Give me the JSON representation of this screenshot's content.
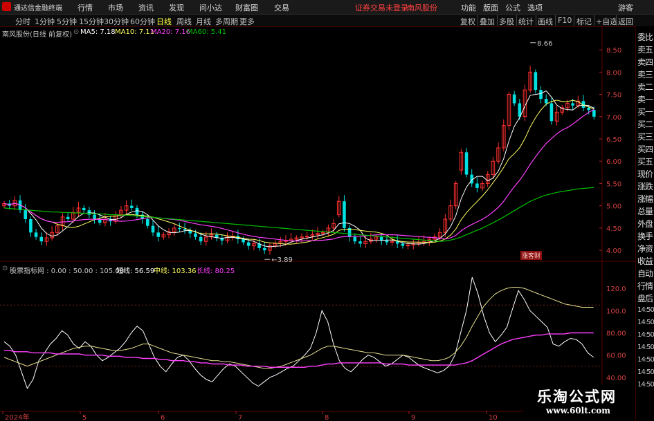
{
  "menubar": {
    "app_name": "通达信金融终端",
    "items": [
      "行情",
      "市场",
      "资讯",
      "发现",
      "问小达",
      "财富圈",
      "交易"
    ],
    "alert1": "证券交易未登录",
    "alert2": "南风股份",
    "right_items": [
      "功能",
      "版面",
      "公式",
      "选项"
    ],
    "guest": "游客"
  },
  "toolbar": {
    "periods": [
      "分时",
      "1分钟",
      "5分钟",
      "15分钟",
      "30分钟",
      "60分钟",
      "日线",
      "周线",
      "月线",
      "多周期",
      "更多"
    ],
    "active_period": "日线",
    "right_items": [
      "复权",
      "叠加",
      "多股",
      "统计",
      "画线",
      "F10",
      "标记",
      "+自选",
      "返回"
    ]
  },
  "kline_legend": {
    "stock": "南风股份(日线 前复权)",
    "ma5": "MA5: 7.18",
    "ma10": "MA10: 7.11",
    "ma20": "MA20: 7.16",
    "ma60": "MA60: 5.41"
  },
  "indicator_legend": {
    "name": "股票指标网 : 0.00 : 50.00 : 105.00",
    "short": "短线: 56.59",
    "mid": "中线: 103.36",
    "long": "长线: 80.25"
  },
  "sidebar": {
    "labels": [
      "委比",
      "卖五",
      "卖四",
      "卖三",
      "卖二",
      "卖一",
      "买一",
      "买二",
      "买三",
      "买四",
      "买五",
      "现价",
      "涨跌",
      "涨幅",
      "总量",
      "外盘",
      "换手",
      "净资",
      "收益",
      "自动",
      "行情",
      "盘后",
      "14:50",
      "14:50",
      "14:50",
      "14:50",
      "14:50",
      "14:50",
      "14:50"
    ]
  },
  "badge": "涨客财",
  "watermark": {
    "line1": "乐淘公式网",
    "line2": "www.60lt.com"
  },
  "colors": {
    "up": "#ff3030",
    "down": "#00e0e0",
    "ma5": "#ffffff",
    "ma10": "#ffff60",
    "ma20": "#ff40ff",
    "ma60": "#00c000"
  },
  "chart_data": [
    {
      "type": "candlestick",
      "title": "南风股份(日线 前复权)",
      "y_ticks": [
        4.0,
        4.5,
        5.0,
        5.5,
        6.0,
        6.5,
        7.0,
        7.5,
        8.0,
        8.5
      ],
      "ylim": [
        3.8,
        8.75
      ],
      "x_ticks": [
        "2024年",
        "5",
        "6",
        "7",
        "8",
        "9",
        "10"
      ],
      "annotations": {
        "high": "8.66",
        "low": "3.89"
      },
      "legend": [
        "MA5: 7.18",
        "MA10: 7.11",
        "MA20: 7.16",
        "MA60: 5.41"
      ],
      "series_close": [
        5.05,
        5.0,
        5.12,
        4.9,
        4.7,
        4.4,
        4.3,
        4.2,
        4.28,
        4.4,
        4.55,
        4.75,
        4.7,
        4.85,
        4.95,
        4.9,
        4.8,
        4.7,
        4.62,
        4.7,
        4.65,
        4.8,
        4.9,
        5.0,
        4.95,
        4.8,
        4.7,
        4.55,
        4.4,
        4.3,
        4.35,
        4.42,
        4.5,
        4.48,
        4.45,
        4.38,
        4.3,
        4.2,
        4.3,
        4.35,
        4.28,
        4.22,
        4.3,
        4.32,
        4.25,
        4.18,
        4.1,
        4.15,
        4.05,
        4.0,
        4.1,
        4.15,
        4.2,
        4.22,
        4.25,
        4.28,
        4.3,
        4.32,
        4.35,
        4.38,
        4.4,
        4.5,
        4.6,
        5.1,
        4.5,
        4.3,
        4.2,
        4.15,
        4.2,
        4.25,
        4.3,
        4.22,
        4.18,
        4.2,
        4.15,
        4.1,
        4.12,
        4.15,
        4.18,
        4.2,
        4.25,
        4.3,
        4.4,
        4.7,
        5.0,
        5.5,
        6.2,
        5.7,
        5.5,
        5.4,
        5.5,
        5.7,
        6.0,
        6.3,
        6.8,
        7.5,
        7.3,
        7.0,
        7.6,
        8.0,
        7.6,
        7.4,
        7.3,
        6.9,
        7.1,
        7.2,
        7.3,
        7.25,
        7.35,
        7.2,
        7.15,
        7.0
      ],
      "series_open": [
        5.0,
        5.05,
        5.0,
        5.12,
        4.9,
        4.7,
        4.4,
        4.3,
        4.2,
        4.28,
        4.4,
        4.55,
        4.75,
        4.7,
        4.85,
        4.95,
        4.9,
        4.8,
        4.7,
        4.62,
        4.7,
        4.65,
        4.8,
        4.9,
        5.0,
        4.95,
        4.8,
        4.7,
        4.55,
        4.4,
        4.3,
        4.35,
        4.42,
        4.5,
        4.48,
        4.45,
        4.38,
        4.3,
        4.2,
        4.3,
        4.35,
        4.28,
        4.22,
        4.3,
        4.32,
        4.25,
        4.18,
        4.1,
        4.15,
        4.05,
        4.0,
        4.1,
        4.15,
        4.2,
        4.22,
        4.25,
        4.28,
        4.3,
        4.32,
        4.35,
        4.38,
        4.4,
        4.5,
        4.8,
        5.1,
        4.5,
        4.3,
        4.2,
        4.15,
        4.2,
        4.25,
        4.3,
        4.22,
        4.18,
        4.2,
        4.15,
        4.1,
        4.12,
        4.15,
        4.18,
        4.2,
        4.25,
        4.3,
        4.4,
        4.7,
        5.0,
        5.8,
        6.2,
        5.7,
        5.5,
        5.4,
        5.5,
        5.7,
        6.0,
        6.3,
        6.8,
        7.5,
        7.3,
        7.0,
        7.6,
        8.0,
        7.6,
        7.4,
        7.3,
        6.9,
        7.1,
        7.2,
        7.3,
        7.25,
        7.35,
        7.2,
        7.15
      ],
      "ma60": [
        4.95,
        4.94,
        4.93,
        4.92,
        4.91,
        4.9,
        4.89,
        4.88,
        4.87,
        4.86,
        4.86,
        4.85,
        4.85,
        4.84,
        4.84,
        4.83,
        4.83,
        4.82,
        4.82,
        4.81,
        4.8,
        4.8,
        4.79,
        4.79,
        4.78,
        4.77,
        4.76,
        4.75,
        4.74,
        4.73,
        4.72,
        4.71,
        4.7,
        4.69,
        4.68,
        4.67,
        4.66,
        4.65,
        4.64,
        4.63,
        4.62,
        4.61,
        4.6,
        4.59,
        4.58,
        4.57,
        4.56,
        4.55,
        4.54,
        4.53,
        4.52,
        4.51,
        4.5,
        4.49,
        4.48,
        4.47,
        4.46,
        4.45,
        4.44,
        4.43,
        4.42,
        4.41,
        4.4,
        4.39,
        4.38,
        4.37,
        4.36,
        4.35,
        4.34,
        4.33,
        4.32,
        4.31,
        4.3,
        4.29,
        4.28,
        4.27,
        4.26,
        4.25,
        4.24,
        4.23,
        4.22,
        4.21,
        4.2,
        4.21,
        4.23,
        4.26,
        4.3,
        4.35,
        4.4,
        4.45,
        4.5,
        4.56,
        4.62,
        4.68,
        4.75,
        4.82,
        4.89,
        4.96,
        5.03,
        5.1,
        5.15,
        5.2,
        5.24,
        5.27,
        5.3,
        5.32,
        5.34,
        5.36,
        5.38,
        5.39,
        5.4,
        5.41
      ]
    },
    {
      "type": "line",
      "title": "股票指标网",
      "y_ticks": [
        40.0,
        60.0,
        80.0,
        100.0,
        120.0
      ],
      "ylim": [
        20,
        135
      ],
      "reference_lines": [
        0,
        50,
        105
      ],
      "series": [
        {
          "name": "短线",
          "values": [
            72,
            68,
            60,
            45,
            30,
            38,
            55,
            62,
            70,
            75,
            82,
            78,
            70,
            66,
            72,
            68,
            60,
            55,
            58,
            62,
            66,
            72,
            80,
            86,
            82,
            70,
            58,
            50,
            45,
            52,
            58,
            60,
            55,
            48,
            42,
            38,
            36,
            42,
            48,
            52,
            50,
            45,
            40,
            35,
            32,
            36,
            40,
            42,
            45,
            48,
            50,
            55,
            60,
            66,
            80,
            100,
            90,
            70,
            55,
            48,
            45,
            50,
            56,
            60,
            58,
            54,
            50,
            52,
            56,
            60,
            58,
            54,
            50,
            48,
            46,
            44,
            46,
            50,
            60,
            80,
            100,
            130,
            115,
            95,
            80,
            72,
            78,
            85,
            102,
            118,
            110,
            100,
            95,
            90,
            85,
            70,
            68,
            72,
            75,
            74,
            70,
            62,
            58
          ]
        },
        {
          "name": "中线",
          "values": [
            58,
            56,
            54,
            52,
            50,
            52,
            54,
            56,
            58,
            60,
            62,
            64,
            66,
            67,
            68,
            68,
            67,
            66,
            65,
            64,
            64,
            65,
            66,
            68,
            70,
            70,
            68,
            66,
            64,
            62,
            61,
            60,
            59,
            58,
            57,
            56,
            55,
            55,
            54,
            54,
            53,
            52,
            51,
            50,
            49,
            48,
            48,
            49,
            50,
            52,
            54,
            56,
            58,
            60,
            63,
            66,
            68,
            68,
            67,
            66,
            65,
            64,
            63,
            62,
            62,
            61,
            60,
            60,
            60,
            60,
            59,
            58,
            57,
            56,
            55,
            55,
            56,
            58,
            62,
            68,
            76,
            86,
            95,
            104,
            110,
            115,
            118,
            120,
            121,
            121,
            120,
            118,
            116,
            114,
            112,
            110,
            108,
            106,
            105,
            104,
            103,
            103,
            103
          ]
        },
        {
          "name": "长线",
          "values": [
            64,
            64,
            63,
            63,
            63,
            62,
            62,
            62,
            62,
            61,
            61,
            61,
            61,
            61,
            60,
            60,
            60,
            60,
            59,
            59,
            59,
            58,
            58,
            58,
            57,
            57,
            57,
            56,
            56,
            55,
            55,
            55,
            54,
            54,
            53,
            53,
            52,
            52,
            52,
            51,
            51,
            51,
            50,
            50,
            50,
            50,
            49,
            49,
            49,
            49,
            49,
            49,
            49,
            50,
            50,
            51,
            52,
            52,
            53,
            53,
            53,
            53,
            53,
            53,
            53,
            53,
            52,
            52,
            52,
            52,
            51,
            51,
            51,
            51,
            51,
            51,
            51,
            51,
            51,
            52,
            53,
            55,
            58,
            61,
            64,
            67,
            70,
            72,
            74,
            75,
            76,
            77,
            78,
            78,
            79,
            79,
            79,
            79,
            80,
            80,
            80,
            80,
            80
          ]
        }
      ]
    }
  ]
}
